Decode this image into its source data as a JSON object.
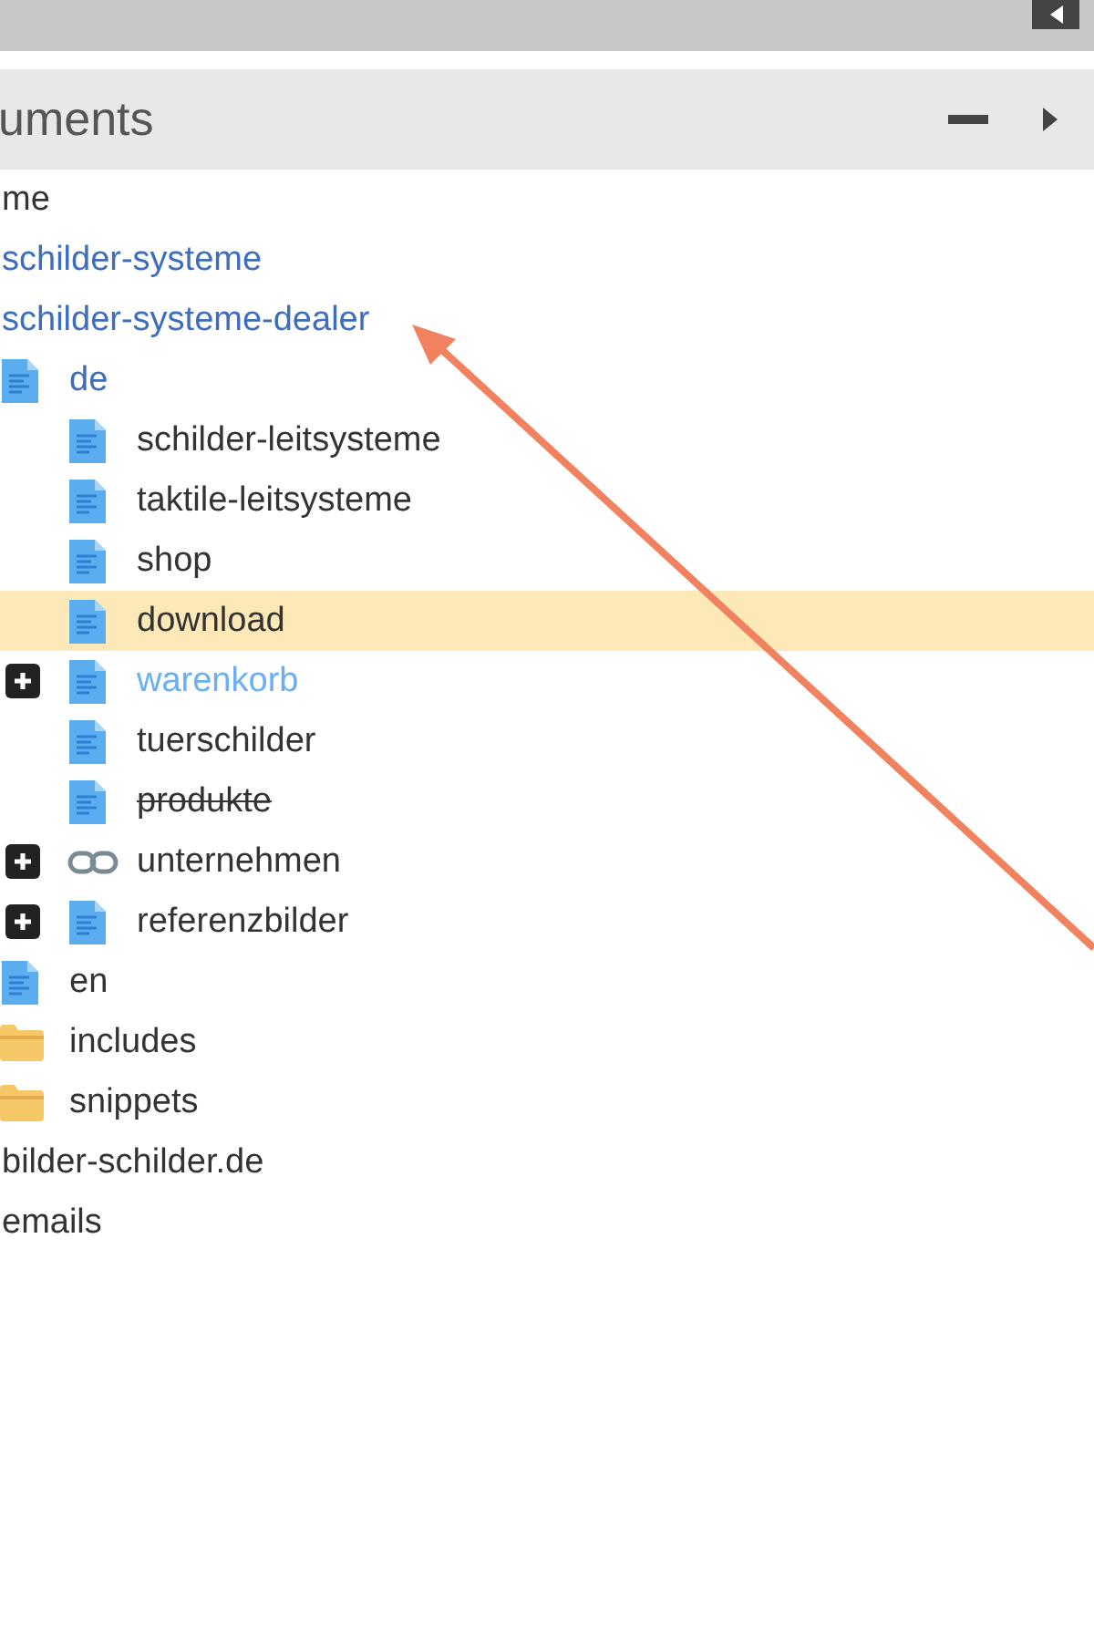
{
  "panel": {
    "title": "uments"
  },
  "tree": [
    {
      "label": "me",
      "site": false,
      "hidden": false,
      "published": true,
      "selected": false
    },
    {
      "label": "schilder-systeme",
      "site": true,
      "hidden": false,
      "published": true,
      "selected": false
    },
    {
      "label": "schilder-systeme-dealer",
      "site": true,
      "hidden": false,
      "published": true,
      "selected": false,
      "children": [
        {
          "label": "de",
          "kind": "page",
          "site": true,
          "hidden": false,
          "published": true,
          "selected": false,
          "children": [
            {
              "label": "schilder-leitsysteme",
              "kind": "page",
              "site": false,
              "hidden": false,
              "published": true,
              "selected": false,
              "collapsed": false
            },
            {
              "label": "taktile-leitsysteme",
              "kind": "page",
              "site": false,
              "hidden": false,
              "published": true,
              "selected": false,
              "collapsed": false
            },
            {
              "label": "shop",
              "kind": "page",
              "site": false,
              "hidden": false,
              "published": true,
              "selected": false,
              "collapsed": false
            },
            {
              "label": "download",
              "kind": "page",
              "site": false,
              "hidden": false,
              "published": true,
              "selected": true,
              "collapsed": false
            },
            {
              "label": "warenkorb",
              "kind": "page",
              "site": false,
              "hidden": true,
              "published": true,
              "selected": false,
              "collapsed": true
            },
            {
              "label": "tuerschilder",
              "kind": "page",
              "site": false,
              "hidden": false,
              "published": true,
              "selected": false,
              "collapsed": false
            },
            {
              "label": "produkte",
              "kind": "page",
              "site": false,
              "hidden": false,
              "published": false,
              "selected": false,
              "collapsed": false
            },
            {
              "label": "unternehmen",
              "kind": "link",
              "site": false,
              "hidden": false,
              "published": true,
              "selected": false,
              "collapsed": true
            },
            {
              "label": "referenzbilder",
              "kind": "page",
              "site": false,
              "hidden": false,
              "published": true,
              "selected": false,
              "collapsed": true
            }
          ]
        },
        {
          "label": "en",
          "kind": "page",
          "site": false,
          "hidden": false,
          "published": true,
          "selected": false
        },
        {
          "label": "includes",
          "kind": "folder",
          "site": false,
          "hidden": false,
          "published": true,
          "selected": false
        },
        {
          "label": "snippets",
          "kind": "folder",
          "site": false,
          "hidden": false,
          "published": true,
          "selected": false
        }
      ]
    },
    {
      "label": "bilder-schilder.de",
      "site": false,
      "hidden": false,
      "published": true,
      "selected": false
    },
    {
      "label": "emails",
      "site": false,
      "hidden": false,
      "published": true,
      "selected": false
    }
  ]
}
